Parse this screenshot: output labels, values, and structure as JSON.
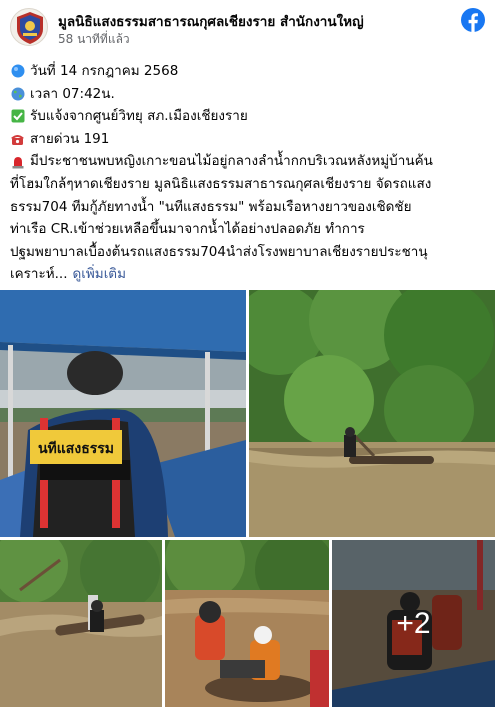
{
  "post": {
    "page_name": "มูลนิธิแสงธรรมสาธารณกุศลเชียงราย สำนักงานใหญ่",
    "time": "58 นาทีที่แล้ว",
    "lines": {
      "date": "วันที่ 14 กรกฎาคม 2568",
      "time": "เวลา 07:42น.",
      "report": "รับแจ้งจากศูนย์วิทยุ สภ.เมืองเชียงราย",
      "hotline": "สายด่วน 191"
    },
    "paragraph": [
      "มีประชาชนพบหญิงเกาะขอนไม้อยู่กลางลำน้ำกกบริเวณหลังหมู่บ้านค้น",
      "ที่โฮมใกล้ๆหาดเชียงราย มูลนิธิแสงธรรมสาธารณกุศลเชียงราย จัดรถแสง",
      "ธรรม704 ทีมกู้ภัยทางน้ำ \"นทีแสงธรรม\" พร้อมเรือหางยาวของเชิดชัย",
      "ท่าเรือ CR.เข้าช่วยเหลือขึ้นมาจากน้ำได้อย่างปลอดภัย ทำการ",
      "ปฐมพยาบาลเบื้องต้นรถแสงธรรม704นำส่งโรงพยาบาลเชียงรายประชานุ",
      "เคราะห์..."
    ],
    "see_more": "ดูเพิ่มเติม",
    "vest_text": "นทีแสงธรรม",
    "more_photos": "+2"
  },
  "colors": {
    "facebook_blue": "#1877f2",
    "link": "#385898",
    "secondary_text": "#65676b"
  },
  "icons": [
    "facebook-logo-icon",
    "blue-circle-icon",
    "globe-icon",
    "check-mark-icon",
    "telephone-icon",
    "siren-icon"
  ]
}
